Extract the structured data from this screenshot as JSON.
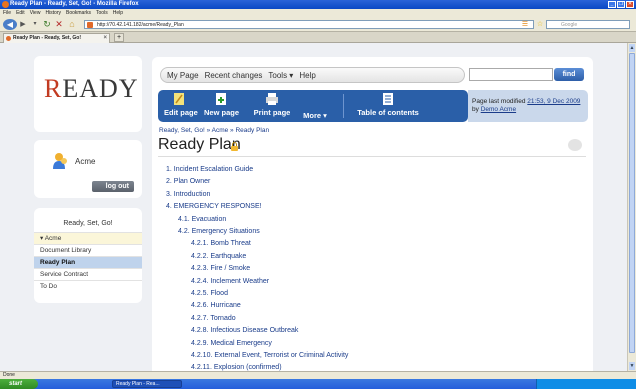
{
  "window": {
    "title": "Ready Plan - Ready, Set, Go! - Mozilla Firefox",
    "controls": [
      "_",
      "❐",
      "✕"
    ]
  },
  "menubar": [
    "File",
    "Edit",
    "View",
    "History",
    "Bookmarks",
    "Tools",
    "Help"
  ],
  "navbar": {
    "url": "http://70.42.141.182/acme/Ready_Plan",
    "search_placeholder": "Google"
  },
  "tab": {
    "label": "Ready Plan - Ready, Set, Go!",
    "new_tab": "+"
  },
  "logo": {
    "text_first": "R",
    "text_rest": "EADY"
  },
  "user": {
    "name": "Acme",
    "logout_label": "log out"
  },
  "site_nav": {
    "home": "Ready, Set, Go!",
    "items": [
      {
        "label": "▾ Acme",
        "state": "group"
      },
      {
        "label": "Document Library",
        "state": "normal"
      },
      {
        "label": "Ready Plan",
        "state": "active"
      },
      {
        "label": "Service Contract",
        "state": "normal"
      },
      {
        "label": "To Do",
        "state": "normal"
      }
    ]
  },
  "topmenu": {
    "my_page": "My Page",
    "recent_changes": "Recent changes",
    "tools": "Tools ▾",
    "help": "Help",
    "find_label": "find"
  },
  "toolbar": {
    "edit_page": "Edit page",
    "new_page": "New page",
    "print_page": "Print page",
    "more": "More ▾",
    "toc": "Table of contents"
  },
  "last_modified": {
    "prefix": "Page last modified",
    "date": "21:53, 9 Dec 2009",
    "by": "by",
    "author": "Demo Acme"
  },
  "breadcrumb": "Ready, Set, Go! » Acme » Ready Plan",
  "page_title": "Ready Plan",
  "toc": [
    {
      "text": "1. Incident Escalation Guide",
      "level": 0
    },
    {
      "text": "2. Plan Owner",
      "level": 0
    },
    {
      "text": "3. Introduction",
      "level": 0
    },
    {
      "text": "4. EMERGENCY RESPONSE!",
      "level": 0
    },
    {
      "text": "4.1. Evacuation",
      "level": 1
    },
    {
      "text": "4.2. Emergency Situations",
      "level": 1
    },
    {
      "text": "4.2.1. Bomb Threat",
      "level": 2
    },
    {
      "text": "4.2.2. Earthquake",
      "level": 2
    },
    {
      "text": "4.2.3. Fire / Smoke",
      "level": 2
    },
    {
      "text": "4.2.4. Inclement Weather",
      "level": 2
    },
    {
      "text": "4.2.5. Flood",
      "level": 2
    },
    {
      "text": "4.2.6. Hurricane",
      "level": 2
    },
    {
      "text": "4.2.7. Tornado",
      "level": 2
    },
    {
      "text": "4.2.8. Infectious Disease Outbreak",
      "level": 2
    },
    {
      "text": "4.2.9. Medical Emergency",
      "level": 2
    },
    {
      "text": "4.2.10. External Event, Terrorist or Criminal Activity",
      "level": 2
    },
    {
      "text": "4.2.11. Explosion (confirmed)",
      "level": 2
    }
  ],
  "statusbar": {
    "text": "Done"
  },
  "taskbar": {
    "start": "start",
    "window": "Ready Plan - Rea..."
  },
  "colors": {
    "accent": "#2a5fa8",
    "link": "#1a3c8a",
    "active_nav": "#bfd3ec",
    "logo_r": "#c23b22"
  }
}
